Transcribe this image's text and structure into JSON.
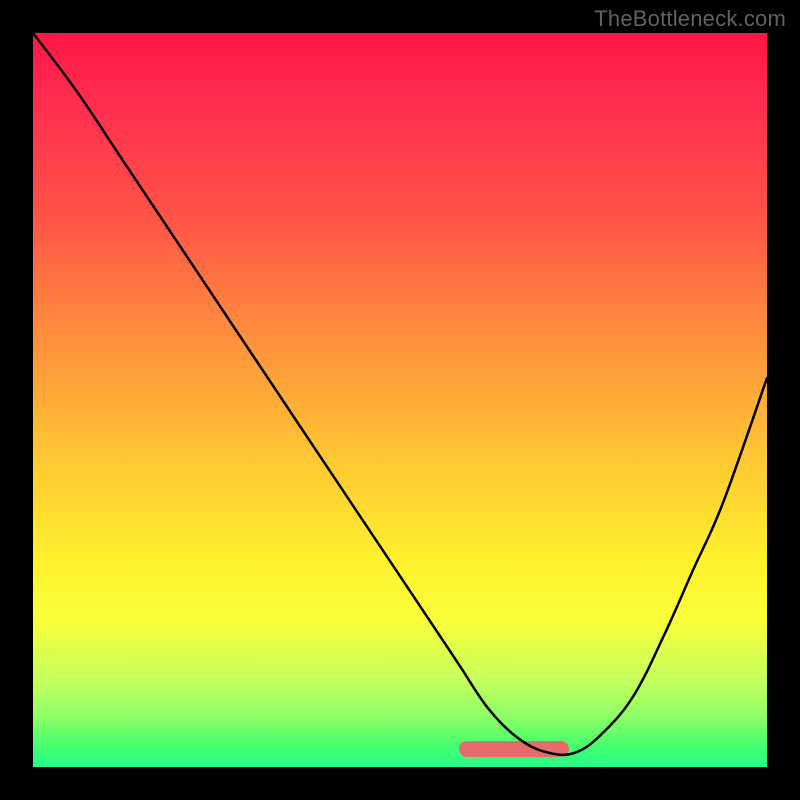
{
  "watermark": "TheBottleneck.com",
  "chart_data": {
    "type": "line",
    "title": "",
    "xlabel": "",
    "ylabel": "",
    "xlim": [
      0,
      100
    ],
    "ylim": [
      0,
      100
    ],
    "curve": {
      "x": [
        0,
        6,
        12,
        18,
        24,
        30,
        36,
        42,
        48,
        54,
        58,
        62,
        66,
        70,
        74,
        78,
        82,
        86,
        90,
        94,
        100
      ],
      "y": [
        100,
        92,
        83,
        74,
        65,
        56,
        47,
        38,
        29,
        20,
        14,
        8,
        4,
        2,
        2,
        5,
        10,
        18,
        27,
        36,
        53
      ]
    },
    "optimum_band": {
      "x_start": 58,
      "x_end": 73,
      "y": 2.5
    },
    "gradient_stops": [
      {
        "pos": 0.0,
        "color": "#ff1744"
      },
      {
        "pos": 0.25,
        "color": "#ff5347"
      },
      {
        "pos": 0.58,
        "color": "#ffc733"
      },
      {
        "pos": 0.8,
        "color": "#f9ff3a"
      },
      {
        "pos": 1.0,
        "color": "#20ff88"
      }
    ]
  }
}
